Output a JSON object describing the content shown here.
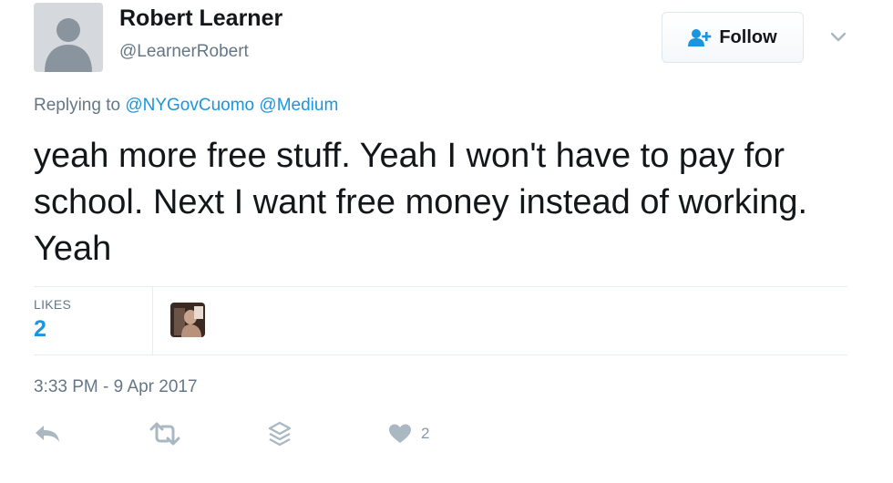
{
  "tweet": {
    "author": {
      "display_name": "Robert Learner",
      "handle": "@LearnerRobert",
      "avatar_icon": "default-egg-avatar"
    },
    "follow_button": {
      "label": "Follow",
      "icon": "add-user-icon"
    },
    "more_menu_icon": "chevron-down-icon",
    "replying_to": {
      "prefix": "Replying to",
      "mentions": [
        "@NYGovCuomo",
        "@Medium"
      ]
    },
    "text": "yeah more free stuff.  Yeah I won't have to pay for school. Next I want free money instead of working.  Yeah",
    "stats": {
      "likes_label": "LIKES",
      "likes_count": "2"
    },
    "timestamp": "3:33 PM - 9 Apr 2017",
    "actions": {
      "reply_icon": "reply-icon",
      "retweet_icon": "retweet-icon",
      "stack_icon": "direct-message-icon",
      "like_icon": "heart-icon",
      "like_count": "2"
    }
  },
  "colors": {
    "link": "#1b95e0",
    "secondary_text": "#657786",
    "icon_gray": "#aab8c2",
    "divider": "#e6ecf0"
  }
}
